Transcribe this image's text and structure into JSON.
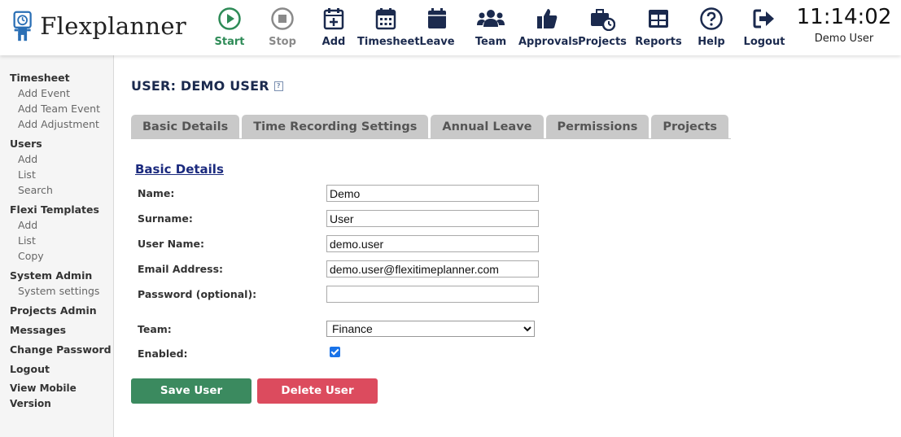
{
  "app": {
    "name": "Flexplanner"
  },
  "nav": [
    {
      "label": "Start",
      "icon": "play-circle-icon"
    },
    {
      "label": "Stop",
      "icon": "stop-circle-icon"
    },
    {
      "label": "Add",
      "icon": "calendar-plus-icon"
    },
    {
      "label": "Timesheet",
      "icon": "calendar-grid-icon"
    },
    {
      "label": "Leave",
      "icon": "calendar-icon"
    },
    {
      "label": "Team",
      "icon": "users-icon"
    },
    {
      "label": "Approvals",
      "icon": "thumbs-up-icon"
    },
    {
      "label": "Projects",
      "icon": "briefcase-clock-icon"
    },
    {
      "label": "Reports",
      "icon": "table-icon"
    },
    {
      "label": "Help",
      "icon": "question-circle-icon"
    },
    {
      "label": "Logout",
      "icon": "sign-out-icon"
    }
  ],
  "header": {
    "time": "11:14:02",
    "user": "Demo User"
  },
  "sidebar": {
    "timesheet": {
      "label": "Timesheet",
      "items": [
        "Add Event",
        "Add Team Event",
        "Add Adjustment"
      ]
    },
    "users": {
      "label": "Users",
      "items": [
        "Add",
        "List",
        "Search"
      ]
    },
    "flexi": {
      "label": "Flexi Templates",
      "items": [
        "Add",
        "List",
        "Copy"
      ]
    },
    "sysadmin": {
      "label": "System Admin",
      "items": [
        "System settings"
      ]
    },
    "projects_admin": "Projects Admin",
    "messages": "Messages",
    "change_password": "Change Password",
    "logout": "Logout",
    "mobile": "View Mobile Version"
  },
  "page": {
    "title": "USER: DEMO USER",
    "help_icon": "help-icon"
  },
  "tabs": [
    "Basic Details",
    "Time Recording Settings",
    "Annual Leave",
    "Permissions",
    "Projects"
  ],
  "form": {
    "section_title": "Basic Details",
    "name": {
      "label": "Name:",
      "value": "Demo"
    },
    "surname": {
      "label": "Surname:",
      "value": "User"
    },
    "username": {
      "label": "User Name:",
      "value": "demo.user"
    },
    "email": {
      "label": "Email Address:",
      "value": "demo.user@flexitimeplanner.com"
    },
    "password": {
      "label": "Password (optional):",
      "value": ""
    },
    "team": {
      "label": "Team:",
      "value": "Finance"
    },
    "enabled": {
      "label": "Enabled:",
      "checked": true
    }
  },
  "buttons": {
    "save": "Save User",
    "delete": "Delete User"
  },
  "colors": {
    "navy": "#1b2a4e",
    "start_green": "#2e8b57",
    "save_green": "#3b8a5f",
    "delete_red": "#dc4b5e"
  }
}
